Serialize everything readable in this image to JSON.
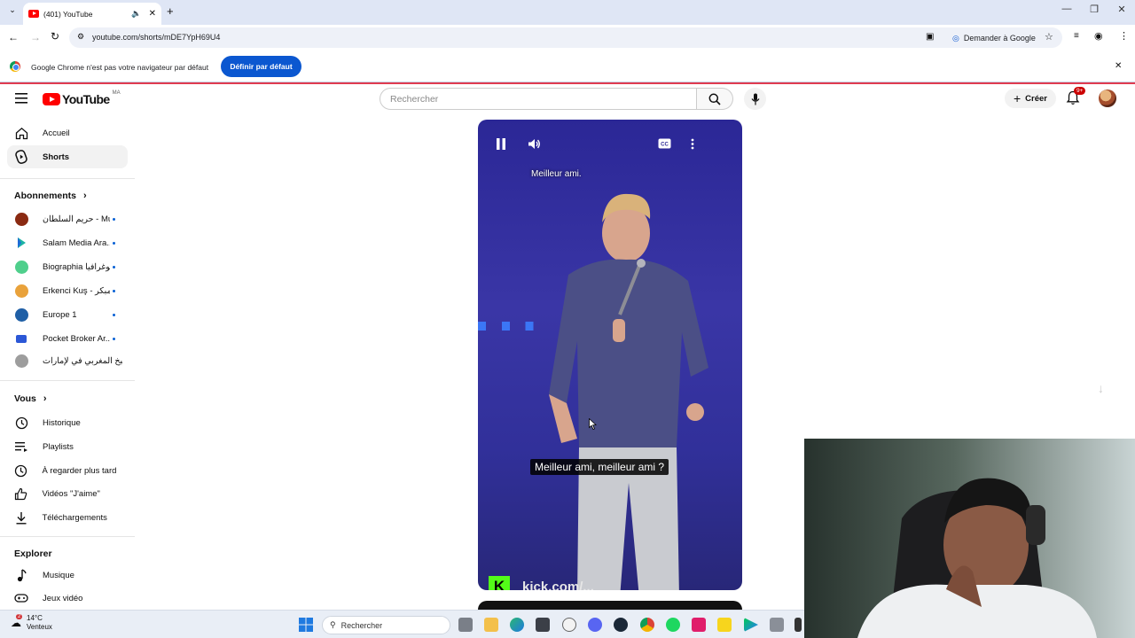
{
  "browser": {
    "tab_title": "(401) YouTube",
    "url": "youtube.com/shorts/mDE7YpH69U4",
    "ask_google": "Demander à Google",
    "banner_message": "Google Chrome n'est pas votre navigateur par défaut",
    "banner_button": "Définir par défaut"
  },
  "header": {
    "logo_text": "YouTube",
    "region": "MA",
    "search_placeholder": "Rechercher",
    "create_label": "Créer",
    "notifications_badge": "9+"
  },
  "sidebar": {
    "main": [
      {
        "label": "Accueil",
        "icon": "home-icon"
      },
      {
        "label": "Shorts",
        "icon": "shorts-icon"
      }
    ],
    "subscriptions_title": "Abonnements",
    "subscriptions": [
      {
        "label": "حريم السلطان - Muht...",
        "color": "#8a2a12"
      },
      {
        "label": "Salam Media Ara...",
        "color": "#1db3a4"
      },
      {
        "label": "Biographia بيوغرافيا",
        "color": "#4fcf8c"
      },
      {
        "label": "Erkenci Kuş - مبكر...",
        "color": "#e9a23b"
      },
      {
        "label": "Europe 1",
        "color": "#1f5fa6"
      },
      {
        "label": "Pocket Broker Ar...",
        "color": "#2b57d6"
      },
      {
        "label": "الطبخ المغربي في لإمارات ...",
        "color": "#9d9d9d"
      }
    ],
    "you_title": "Vous",
    "you": [
      {
        "label": "Historique",
        "icon": "history-icon"
      },
      {
        "label": "Playlists",
        "icon": "playlists-icon"
      },
      {
        "label": "À regarder plus tard",
        "icon": "clock-icon"
      },
      {
        "label": "Vidéos \"J'aime\"",
        "icon": "thumb-up-icon"
      },
      {
        "label": "Téléchargements",
        "icon": "download-icon"
      }
    ],
    "explore_title": "Explorer",
    "explore": [
      {
        "label": "Musique",
        "icon": "music-icon"
      },
      {
        "label": "Jeux vidéo",
        "icon": "gaming-icon"
      }
    ]
  },
  "video": {
    "caption_top": "Meilleur ami.",
    "caption_bottom": "Meilleur ami, meilleur ami ?",
    "watermark": "kick.com/...",
    "state": "playing"
  },
  "taskbar": {
    "temperature": "14°C",
    "weather": "Venteux",
    "weather_badge": "2",
    "search_label": "Rechercher"
  }
}
